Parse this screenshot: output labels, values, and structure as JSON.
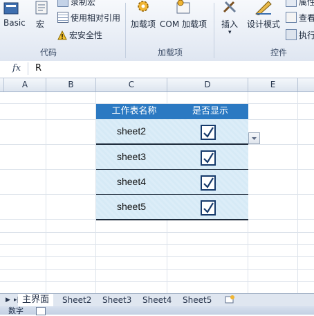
{
  "ribbon": {
    "basic_label": "Basic",
    "macro_label": "宏",
    "record_macro_label": "录制宏",
    "relative_ref_label": "使用相对引用",
    "macro_security_label": "宏安全性",
    "code_group": "代码",
    "addins_label": "加载项",
    "com_addins_label": "COM 加载项",
    "addins_group": "加载项",
    "insert_label": "插入",
    "design_mode_label": "设计模式",
    "properties_label": "属性",
    "view_code_label": "查看",
    "run_dialog_label": "执行",
    "controls_group": "控件"
  },
  "formula_bar": {
    "fx_label": "fx",
    "value": "R"
  },
  "columns": [
    "A",
    "B",
    "C",
    "D",
    "E"
  ],
  "table": {
    "header_name": "工作表名称",
    "header_show": "是否显示",
    "rows": [
      {
        "name": "sheet2",
        "checked": true
      },
      {
        "name": "sheet3",
        "checked": true
      },
      {
        "name": "sheet4",
        "checked": true
      },
      {
        "name": "sheet5",
        "checked": true
      }
    ]
  },
  "tabs": {
    "active": "主界面",
    "items": [
      "Sheet2",
      "Sheet3",
      "Sheet4",
      "Sheet5"
    ]
  },
  "status": {
    "mode": "数字"
  },
  "colors": {
    "header_bg": "#2b79c2",
    "row_bg": "#d6eaf6",
    "check_border": "#163a6b"
  }
}
